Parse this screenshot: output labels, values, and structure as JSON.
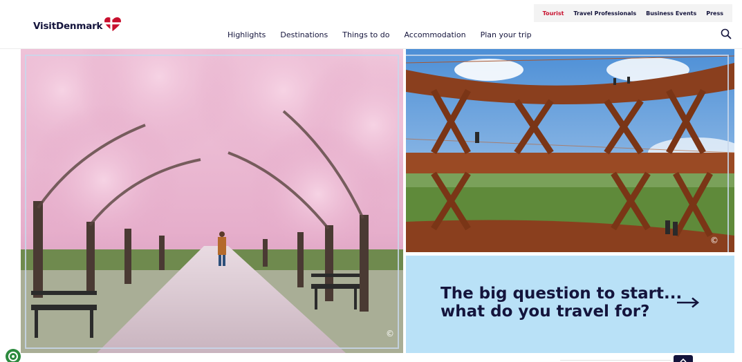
{
  "topbar": {
    "links": [
      {
        "label": "Tourist",
        "active": true
      },
      {
        "label": "Travel Professionals",
        "active": false
      },
      {
        "label": "Business Events",
        "active": false
      },
      {
        "label": "Press",
        "active": false
      }
    ]
  },
  "logo": {
    "text": "VisitDenmark"
  },
  "nav": {
    "items": [
      "Highlights",
      "Destinations",
      "Things to do",
      "Accommodation",
      "Plan your trip"
    ]
  },
  "search": {
    "icon": "search-icon"
  },
  "hero": {
    "left_copyright": "©",
    "right_copyright": "©"
  },
  "cta": {
    "line1": "The big question to start...",
    "line2": "what do you travel for?",
    "icon": "arrow-right-icon"
  },
  "colors": {
    "brand_red": "#c8102e",
    "navy": "#14143c",
    "cta_bg": "#b9e1f7"
  }
}
